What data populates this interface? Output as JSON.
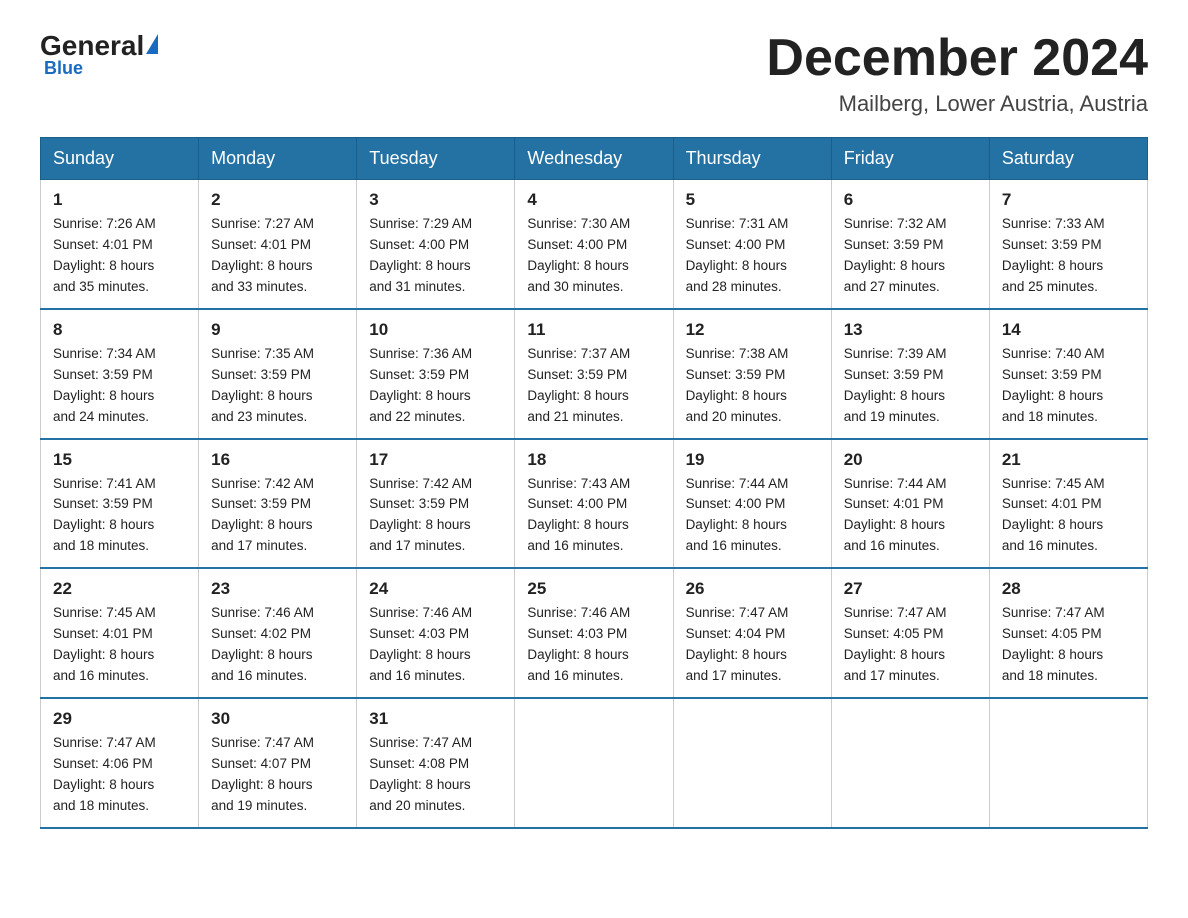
{
  "header": {
    "logo_general": "General",
    "logo_blue": "Blue",
    "calendar_title": "December 2024",
    "calendar_subtitle": "Mailberg, Lower Austria, Austria"
  },
  "days_of_week": [
    "Sunday",
    "Monday",
    "Tuesday",
    "Wednesday",
    "Thursday",
    "Friday",
    "Saturday"
  ],
  "weeks": [
    [
      {
        "day": "1",
        "sunrise": "7:26 AM",
        "sunset": "4:01 PM",
        "daylight": "8 hours and 35 minutes."
      },
      {
        "day": "2",
        "sunrise": "7:27 AM",
        "sunset": "4:01 PM",
        "daylight": "8 hours and 33 minutes."
      },
      {
        "day": "3",
        "sunrise": "7:29 AM",
        "sunset": "4:00 PM",
        "daylight": "8 hours and 31 minutes."
      },
      {
        "day": "4",
        "sunrise": "7:30 AM",
        "sunset": "4:00 PM",
        "daylight": "8 hours and 30 minutes."
      },
      {
        "day": "5",
        "sunrise": "7:31 AM",
        "sunset": "4:00 PM",
        "daylight": "8 hours and 28 minutes."
      },
      {
        "day": "6",
        "sunrise": "7:32 AM",
        "sunset": "3:59 PM",
        "daylight": "8 hours and 27 minutes."
      },
      {
        "day": "7",
        "sunrise": "7:33 AM",
        "sunset": "3:59 PM",
        "daylight": "8 hours and 25 minutes."
      }
    ],
    [
      {
        "day": "8",
        "sunrise": "7:34 AM",
        "sunset": "3:59 PM",
        "daylight": "8 hours and 24 minutes."
      },
      {
        "day": "9",
        "sunrise": "7:35 AM",
        "sunset": "3:59 PM",
        "daylight": "8 hours and 23 minutes."
      },
      {
        "day": "10",
        "sunrise": "7:36 AM",
        "sunset": "3:59 PM",
        "daylight": "8 hours and 22 minutes."
      },
      {
        "day": "11",
        "sunrise": "7:37 AM",
        "sunset": "3:59 PM",
        "daylight": "8 hours and 21 minutes."
      },
      {
        "day": "12",
        "sunrise": "7:38 AM",
        "sunset": "3:59 PM",
        "daylight": "8 hours and 20 minutes."
      },
      {
        "day": "13",
        "sunrise": "7:39 AM",
        "sunset": "3:59 PM",
        "daylight": "8 hours and 19 minutes."
      },
      {
        "day": "14",
        "sunrise": "7:40 AM",
        "sunset": "3:59 PM",
        "daylight": "8 hours and 18 minutes."
      }
    ],
    [
      {
        "day": "15",
        "sunrise": "7:41 AM",
        "sunset": "3:59 PM",
        "daylight": "8 hours and 18 minutes."
      },
      {
        "day": "16",
        "sunrise": "7:42 AM",
        "sunset": "3:59 PM",
        "daylight": "8 hours and 17 minutes."
      },
      {
        "day": "17",
        "sunrise": "7:42 AM",
        "sunset": "3:59 PM",
        "daylight": "8 hours and 17 minutes."
      },
      {
        "day": "18",
        "sunrise": "7:43 AM",
        "sunset": "4:00 PM",
        "daylight": "8 hours and 16 minutes."
      },
      {
        "day": "19",
        "sunrise": "7:44 AM",
        "sunset": "4:00 PM",
        "daylight": "8 hours and 16 minutes."
      },
      {
        "day": "20",
        "sunrise": "7:44 AM",
        "sunset": "4:01 PM",
        "daylight": "8 hours and 16 minutes."
      },
      {
        "day": "21",
        "sunrise": "7:45 AM",
        "sunset": "4:01 PM",
        "daylight": "8 hours and 16 minutes."
      }
    ],
    [
      {
        "day": "22",
        "sunrise": "7:45 AM",
        "sunset": "4:01 PM",
        "daylight": "8 hours and 16 minutes."
      },
      {
        "day": "23",
        "sunrise": "7:46 AM",
        "sunset": "4:02 PM",
        "daylight": "8 hours and 16 minutes."
      },
      {
        "day": "24",
        "sunrise": "7:46 AM",
        "sunset": "4:03 PM",
        "daylight": "8 hours and 16 minutes."
      },
      {
        "day": "25",
        "sunrise": "7:46 AM",
        "sunset": "4:03 PM",
        "daylight": "8 hours and 16 minutes."
      },
      {
        "day": "26",
        "sunrise": "7:47 AM",
        "sunset": "4:04 PM",
        "daylight": "8 hours and 17 minutes."
      },
      {
        "day": "27",
        "sunrise": "7:47 AM",
        "sunset": "4:05 PM",
        "daylight": "8 hours and 17 minutes."
      },
      {
        "day": "28",
        "sunrise": "7:47 AM",
        "sunset": "4:05 PM",
        "daylight": "8 hours and 18 minutes."
      }
    ],
    [
      {
        "day": "29",
        "sunrise": "7:47 AM",
        "sunset": "4:06 PM",
        "daylight": "8 hours and 18 minutes."
      },
      {
        "day": "30",
        "sunrise": "7:47 AM",
        "sunset": "4:07 PM",
        "daylight": "8 hours and 19 minutes."
      },
      {
        "day": "31",
        "sunrise": "7:47 AM",
        "sunset": "4:08 PM",
        "daylight": "8 hours and 20 minutes."
      },
      null,
      null,
      null,
      null
    ]
  ],
  "labels": {
    "sunrise_prefix": "Sunrise: ",
    "sunset_prefix": "Sunset: ",
    "daylight_prefix": "Daylight: "
  }
}
